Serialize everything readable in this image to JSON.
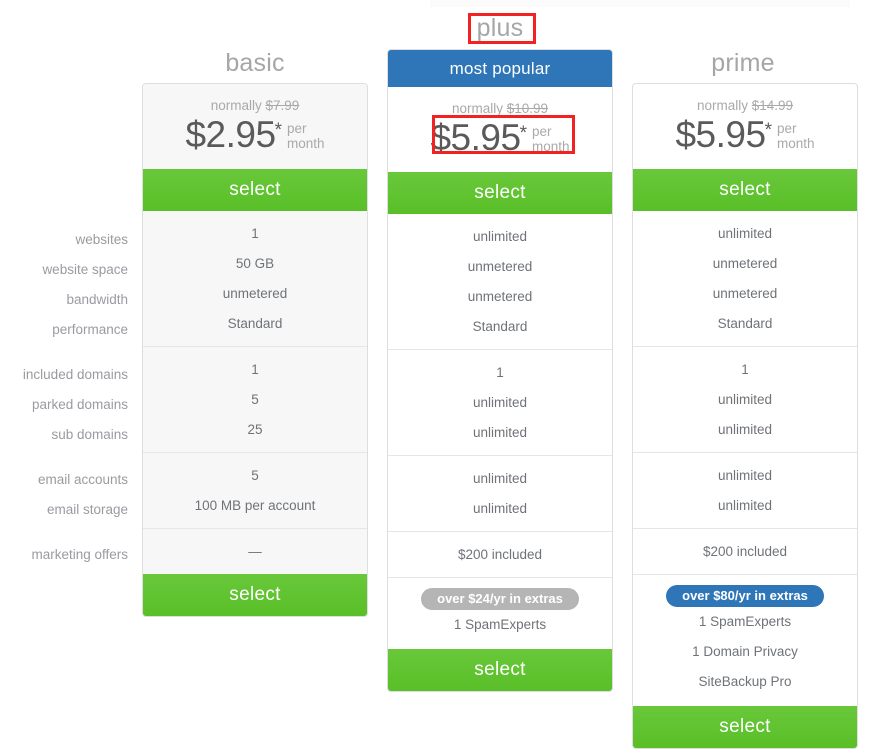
{
  "row_labels": [
    {
      "label": "websites"
    },
    {
      "label": "website space"
    },
    {
      "label": "bandwidth"
    },
    {
      "label": "performance"
    },
    {
      "label": "included domains"
    },
    {
      "label": "parked domains"
    },
    {
      "label": "sub domains"
    },
    {
      "label": "email accounts"
    },
    {
      "label": "email storage"
    },
    {
      "label": "marketing offers"
    }
  ],
  "plans": {
    "basic": {
      "title": "basic",
      "normally_prefix": "normally",
      "normally_price": "$7.99",
      "price": "$2.95",
      "star": "*",
      "per_line1": "per",
      "per_line2": "month",
      "select_top_label": "select",
      "select_bottom_label": "select",
      "features": {
        "websites": "1",
        "website_space": "50 GB",
        "bandwidth": "unmetered",
        "performance": "Standard",
        "included_domains": "1",
        "parked_domains": "5",
        "sub_domains": "25",
        "email_accounts": "5",
        "email_storage": "100 MB per account",
        "marketing_offers": "—"
      },
      "extras_badge": null,
      "extras_items": []
    },
    "plus": {
      "title": "plus",
      "banner": "most popular",
      "normally_prefix": "normally",
      "normally_price": "$10.99",
      "price": "$5.95",
      "star": "*",
      "per_line1": "per",
      "per_line2": "month",
      "select_top_label": "select",
      "select_bottom_label": "select",
      "features": {
        "websites": "unlimited",
        "website_space": "unmetered",
        "bandwidth": "unmetered",
        "performance": "Standard",
        "included_domains": "1",
        "parked_domains": "unlimited",
        "sub_domains": "unlimited",
        "email_accounts": "unlimited",
        "email_storage": "unlimited",
        "marketing_offers": "$200 included"
      },
      "extras_badge": "over $24/yr in extras",
      "extras_badge_color": "#b5b5b5",
      "extras_items": [
        {
          "label": "1 SpamExperts"
        }
      ]
    },
    "prime": {
      "title": "prime",
      "normally_prefix": "normally",
      "normally_price": "$14.99",
      "price": "$5.95",
      "star": "*",
      "per_line1": "per",
      "per_line2": "month",
      "select_top_label": "select",
      "select_bottom_label": "select",
      "features": {
        "websites": "unlimited",
        "website_space": "unmetered",
        "bandwidth": "unmetered",
        "performance": "Standard",
        "included_domains": "1",
        "parked_domains": "unlimited",
        "sub_domains": "unlimited",
        "email_accounts": "unlimited",
        "email_storage": "unlimited",
        "marketing_offers": "$200 included"
      },
      "extras_badge": "over $80/yr in extras",
      "extras_badge_color": "#2e76b8",
      "extras_items": [
        {
          "label": "1 SpamExperts"
        },
        {
          "label": "1 Domain Privacy"
        },
        {
          "label": "SiteBackup Pro"
        }
      ]
    }
  },
  "colors": {
    "green_select": "#5fc22e",
    "blue_accent": "#2e76b8",
    "gray_badge": "#b5b5b5",
    "annotation_red": "#f32222",
    "label_text": "#999ba0",
    "value_text": "#6f7378"
  }
}
